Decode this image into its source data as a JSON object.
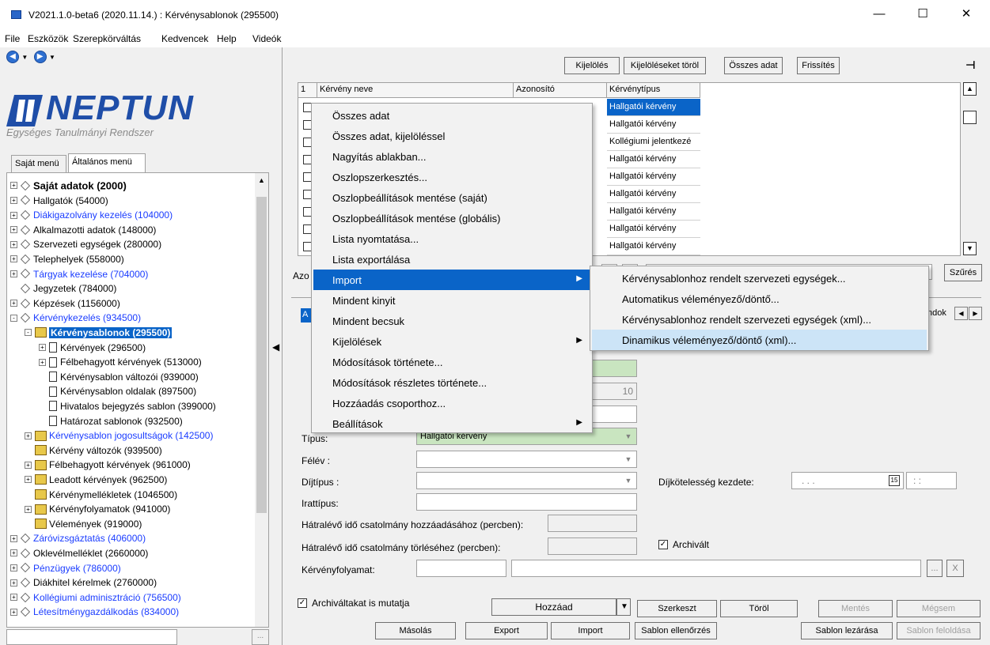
{
  "window": {
    "title": "V2021.1.0-beta6 (2020.11.14.) : Kérvénysablonok (295500)",
    "min": "—",
    "max": "☐",
    "close": "✕"
  },
  "menubar": [
    "File",
    "Eszközök",
    "Szerepkörváltás",
    "Kedvencek",
    "Help",
    "Videók"
  ],
  "logo": {
    "name": "NEPTUN",
    "subtitle": "Egységes Tanulmányi Rendszer"
  },
  "left_tabs": [
    "Saját menü",
    "Általános menü"
  ],
  "tree": [
    {
      "label": "Saját adatok (2000)",
      "style": "bold",
      "icon": "dia",
      "exp": "+"
    },
    {
      "label": "Hallgatók (54000)",
      "style": "",
      "icon": "dia",
      "exp": "+"
    },
    {
      "label": "Diákigazolvány kezelés (104000)",
      "style": "blue",
      "icon": "dia",
      "exp": "+"
    },
    {
      "label": "Alkalmazotti adatok (148000)",
      "style": "",
      "icon": "dia",
      "exp": "+"
    },
    {
      "label": "Szervezeti egységek (280000)",
      "style": "",
      "icon": "dia",
      "exp": "+"
    },
    {
      "label": "Telephelyek (558000)",
      "style": "",
      "icon": "dia",
      "exp": "+"
    },
    {
      "label": "Tárgyak kezelése (704000)",
      "style": "blue",
      "icon": "dia",
      "exp": "+"
    },
    {
      "label": "Jegyzetek (784000)",
      "style": "",
      "icon": "dia",
      "exp": ""
    },
    {
      "label": "Képzések (1156000)",
      "style": "",
      "icon": "dia",
      "exp": "+"
    },
    {
      "label": "Kérvénykezelés (934500)",
      "style": "blue",
      "icon": "dia",
      "exp": "-"
    },
    {
      "label": "Kérvénysablonok (295500)",
      "style": "sel",
      "icon": "fold",
      "exp": "-",
      "indent": 1
    },
    {
      "label": "Kérvények (296500)",
      "style": "",
      "icon": "doc",
      "exp": "+",
      "indent": 2
    },
    {
      "label": "Félbehagyott kérvények (513000)",
      "style": "",
      "icon": "doc",
      "exp": "+",
      "indent": 2
    },
    {
      "label": "Kérvénysablon változói (939000)",
      "style": "",
      "icon": "doc",
      "exp": "",
      "indent": 2
    },
    {
      "label": "Kérvénysablon oldalak (897500)",
      "style": "",
      "icon": "doc",
      "exp": "",
      "indent": 2
    },
    {
      "label": "Hivatalos bejegyzés sablon (399000)",
      "style": "",
      "icon": "doc",
      "exp": "",
      "indent": 2
    },
    {
      "label": "Határozat sablonok (932500)",
      "style": "",
      "icon": "doc",
      "exp": "",
      "indent": 2
    },
    {
      "label": "Kérvénysablon jogosultságok (142500)",
      "style": "blue",
      "icon": "fold",
      "exp": "+",
      "indent": 1
    },
    {
      "label": "Kérvény változók (939500)",
      "style": "",
      "icon": "fold",
      "exp": "",
      "indent": 1
    },
    {
      "label": "Félbehagyott kérvények (961000)",
      "style": "",
      "icon": "fold",
      "exp": "+",
      "indent": 1
    },
    {
      "label": "Leadott kérvények (962500)",
      "style": "",
      "icon": "fold",
      "exp": "+",
      "indent": 1
    },
    {
      "label": "Kérvénymellékletek (1046500)",
      "style": "",
      "icon": "fold",
      "exp": "",
      "indent": 1
    },
    {
      "label": "Kérvényfolyamatok (941000)",
      "style": "",
      "icon": "fold",
      "exp": "+",
      "indent": 1
    },
    {
      "label": "Vélemények (919000)",
      "style": "",
      "icon": "fold",
      "exp": "",
      "indent": 1
    },
    {
      "label": "Záróvizsgáztatás (406000)",
      "style": "blue",
      "icon": "dia",
      "exp": "+"
    },
    {
      "label": "Oklevélmelléklet (2660000)",
      "style": "",
      "icon": "dia",
      "exp": "+"
    },
    {
      "label": "Pénzügyek (786000)",
      "style": "blue",
      "icon": "dia",
      "exp": "+"
    },
    {
      "label": "Diákhitel kérelmek (2760000)",
      "style": "",
      "icon": "dia",
      "exp": "+"
    },
    {
      "label": "Kollégiumi adminisztráció (756500)",
      "style": "blue",
      "icon": "dia",
      "exp": "+"
    },
    {
      "label": "Létesítménygazdálkodás (834000)",
      "style": "blue",
      "icon": "dia",
      "exp": "+"
    }
  ],
  "toolbar": {
    "kijeloles": "Kijelölés",
    "kijeloleseket_torol": "Kijelöléseket töröl",
    "osszes_adat": "Összes adat",
    "frissites": "Frissítés",
    "pin": "⊣"
  },
  "grid": {
    "headers": [
      "1",
      "Kérvény neve",
      "Azonosító",
      "Kérvénytípus"
    ],
    "types": [
      "Hallgatói kérvény",
      "Hallgatói kérvény",
      "Kollégiumi jelentkezé",
      "Hallgatói kérvény",
      "Hallgatói kérvény",
      "Hallgatói kérvény",
      "Hallgatói kérvény",
      "Hallgatói kérvény",
      "Hallgatói kérvény"
    ]
  },
  "filter": {
    "label_fragment": "Azo",
    "szures": "Szűrés"
  },
  "tab_fragment": {
    "left": "A",
    "right": "ndok"
  },
  "context_menu": [
    {
      "label": "Összes adat",
      "u": "Ö"
    },
    {
      "label": "Összes adat, kijelöléssel",
      "u": "z"
    },
    {
      "label": "Nagyítás ablakban...",
      "u": "N"
    },
    {
      "label": "Oszlopszerkesztés...",
      "u": "O"
    },
    {
      "label": "Oszlopbeállítások mentése (saját)",
      "u": "l"
    },
    {
      "label": "Oszlopbeállítások mentése (globális)",
      "u": "p"
    },
    {
      "label": "Lista nyomtatása...",
      "u": "i"
    },
    {
      "label": "Lista exportálása",
      "u": "t"
    },
    {
      "label": "Import",
      "u": "r",
      "sub": true,
      "hl": true
    },
    {
      "label": "Mindent kinyit",
      "u": "d"
    },
    {
      "label": "Mindent becsuk",
      "u": "c"
    },
    {
      "label": "Kijelölések",
      "u": "K",
      "sub": true
    },
    {
      "label": "Módosítások története...",
      "u": "M"
    },
    {
      "label": "Módosítások részletes története...",
      "u": "o"
    },
    {
      "label": "Hozzáadás csoporthoz...",
      "u": "H"
    },
    {
      "label": "Beállítások",
      "u": "B",
      "sub": true
    }
  ],
  "submenu": [
    {
      "label": "Kérvénysablonhoz rendelt szervezeti egységek..."
    },
    {
      "label": "Automatikus véleményező/döntő..."
    },
    {
      "label": "Kérvénysablonhoz rendelt szervezeti egységek (xml)..."
    },
    {
      "label": "Dinamikus véleményező/döntő (xml)...",
      "hl": true
    }
  ],
  "form": {
    "field_10": "10",
    "tipus_label": "Típus:",
    "tipus_value": "Hallgatói kérvény",
    "felev_label": "Félév :",
    "dijtipus_label": "Díjtípus :",
    "irattipus_label": "Irattípus:",
    "dijkot_label": "Díjkötelesség kezdete:",
    "date_placeholder": ". . .",
    "time_placeholder": ": :",
    "hatr_hozza_label": "Hátralévő idő csatolmány hozzáadásához (percben):",
    "hatr_torl_label": "Hátralévő idő csatolmány törléséhez (percben):",
    "archivalt_label": "Archivált",
    "folyamat_label": "Kérvényfolyamat:",
    "browse": "...",
    "clear": "X"
  },
  "bottom": {
    "archivaltakat": "Archiváltakat is mutatja",
    "hozzaad": "Hozzáad",
    "szerkeszt": "Szerkeszt",
    "torol": "Töröl",
    "mentes": "Mentés",
    "megsem": "Mégsem",
    "masolas": "Másolás",
    "export": "Export",
    "import": "Import",
    "sablon_ellenorzes": "Sablon ellenőrzés",
    "sablon_lezarasa": "Sablon lezárása",
    "sablon_feloldasa": "Sablon feloldása"
  }
}
